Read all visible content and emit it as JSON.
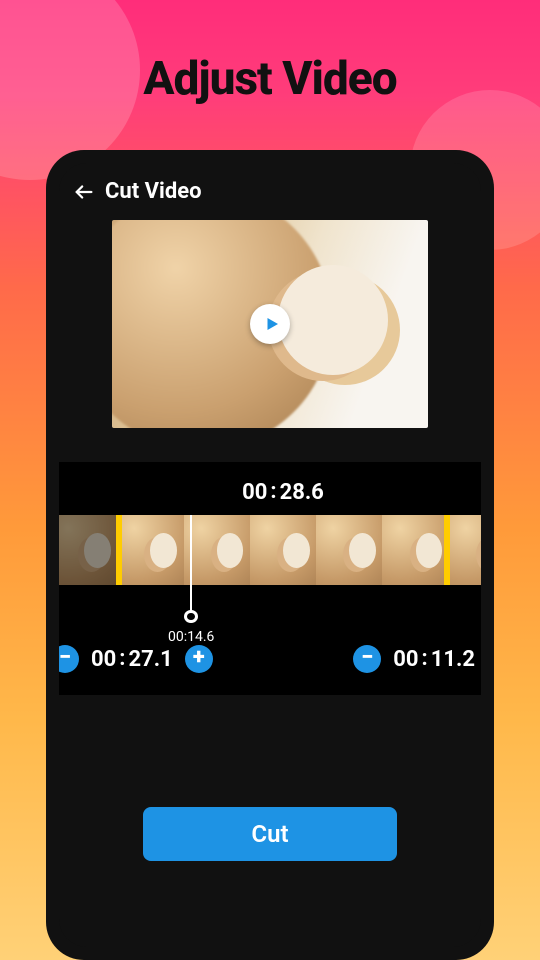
{
  "promo": {
    "title": "Adjust Video"
  },
  "appbar": {
    "title": "Cut Video"
  },
  "duration": {
    "mm": "00",
    "ss": "28.6"
  },
  "playhead": {
    "time": "00:14.6"
  },
  "start": {
    "mm": "00",
    "ss": "27.1"
  },
  "end": {
    "mm": "00",
    "ss": "11.2"
  },
  "buttons": {
    "cut": "Cut"
  },
  "colors": {
    "accent": "#1e93e4",
    "selection": "#ffcc00"
  }
}
